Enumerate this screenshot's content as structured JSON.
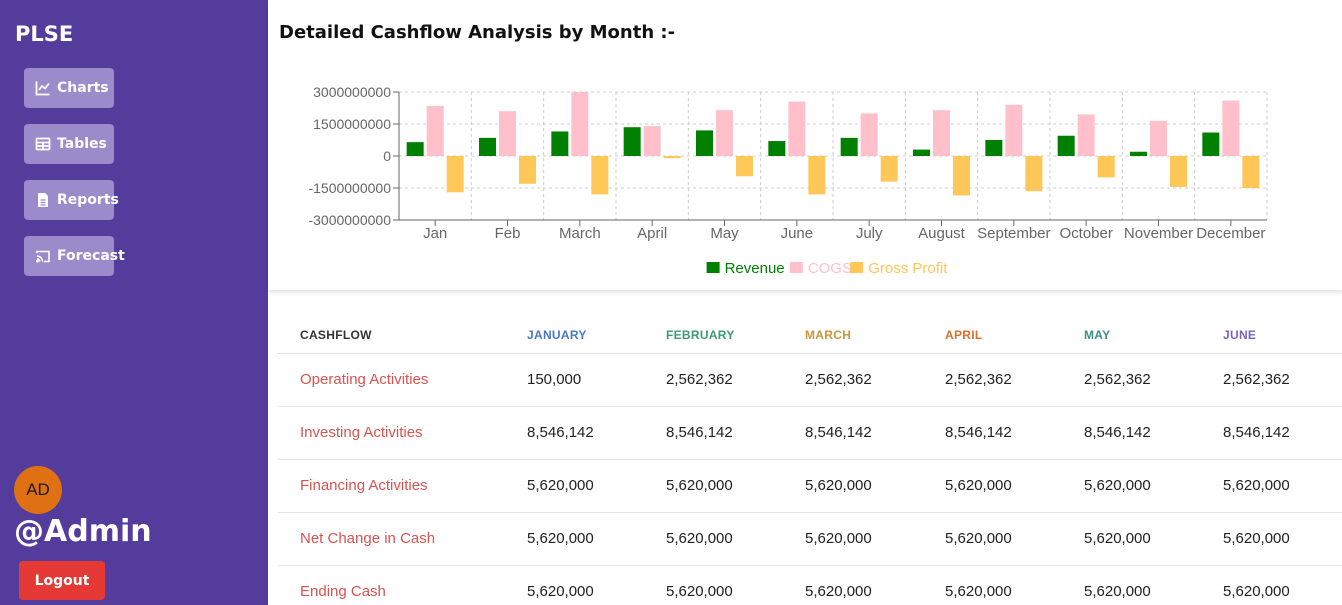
{
  "sidebar": {
    "brand": "PLSE",
    "nav": [
      {
        "label": "Charts",
        "icon": "line-chart-icon"
      },
      {
        "label": "Tables",
        "icon": "table-icon"
      },
      {
        "label": "Reports",
        "icon": "file-icon"
      },
      {
        "label": "Forecast",
        "icon": "cast-icon"
      }
    ],
    "avatar_initials": "AD",
    "username": "@Admin",
    "logout_label": "Logout",
    "colors": {
      "background": "#543c9c",
      "button": "#9b8bca",
      "logout": "#e53935",
      "avatar": "#e07014"
    }
  },
  "page": {
    "title": "Detailed Cashflow Analysis by Month :-"
  },
  "chart_data": {
    "type": "bar",
    "categories": [
      "Jan",
      "Feb",
      "March",
      "April",
      "May",
      "June",
      "July",
      "August",
      "September",
      "October",
      "November",
      "December"
    ],
    "series": [
      {
        "name": "Revenue",
        "color": "#008000",
        "values": [
          650000000,
          850000000,
          1150000000,
          1350000000,
          1200000000,
          700000000,
          850000000,
          300000000,
          750000000,
          950000000,
          200000000,
          1100000000
        ]
      },
      {
        "name": "COGS",
        "color": "#ffc0cb",
        "values": [
          2350000000,
          2100000000,
          3000000000,
          1400000000,
          2150000000,
          2550000000,
          2000000000,
          2150000000,
          2400000000,
          1950000000,
          1650000000,
          2600000000
        ]
      },
      {
        "name": "Gross Profit",
        "color": "#ffc658",
        "values": [
          -1700000000,
          -1300000000,
          -1800000000,
          -100000000,
          -950000000,
          -1800000000,
          -1200000000,
          -1850000000,
          -1650000000,
          -1000000000,
          -1450000000,
          -1500000000
        ]
      }
    ],
    "yticks": [
      "3000000000",
      "1500000000",
      "0",
      "-1500000000",
      "-3000000000"
    ],
    "ylim": [
      -3000000000,
      3000000000
    ],
    "grid": true,
    "legend": "bottom"
  },
  "table": {
    "header_label": "CASHFLOW",
    "months": [
      {
        "label": "JANUARY",
        "color": "#4a77c4"
      },
      {
        "label": "FEBRUARY",
        "color": "#3d9a72"
      },
      {
        "label": "MARCH",
        "color": "#c9963a"
      },
      {
        "label": "APRIL",
        "color": "#d9702c"
      },
      {
        "label": "MAY",
        "color": "#3b9088"
      },
      {
        "label": "JUNE",
        "color": "#7a63c6"
      }
    ],
    "rows": [
      {
        "label": "Operating Activities",
        "values": [
          "150,000",
          "2,562,362",
          "2,562,362",
          "2,562,362",
          "2,562,362",
          "2,562,362"
        ]
      },
      {
        "label": "Investing Activities",
        "values": [
          "8,546,142",
          "8,546,142",
          "8,546,142",
          "8,546,142",
          "8,546,142",
          "8,546,142"
        ]
      },
      {
        "label": "Financing Activities",
        "values": [
          "5,620,000",
          "5,620,000",
          "5,620,000",
          "5,620,000",
          "5,620,000",
          "5,620,000"
        ]
      },
      {
        "label": "Net Change in Cash",
        "values": [
          "5,620,000",
          "5,620,000",
          "5,620,000",
          "5,620,000",
          "5,620,000",
          "5,620,000"
        ]
      },
      {
        "label": "Ending Cash",
        "values": [
          "5,620,000",
          "5,620,000",
          "5,620,000",
          "5,620,000",
          "5,620,000",
          "5,620,000"
        ]
      }
    ],
    "label_color": "#d9534f"
  }
}
